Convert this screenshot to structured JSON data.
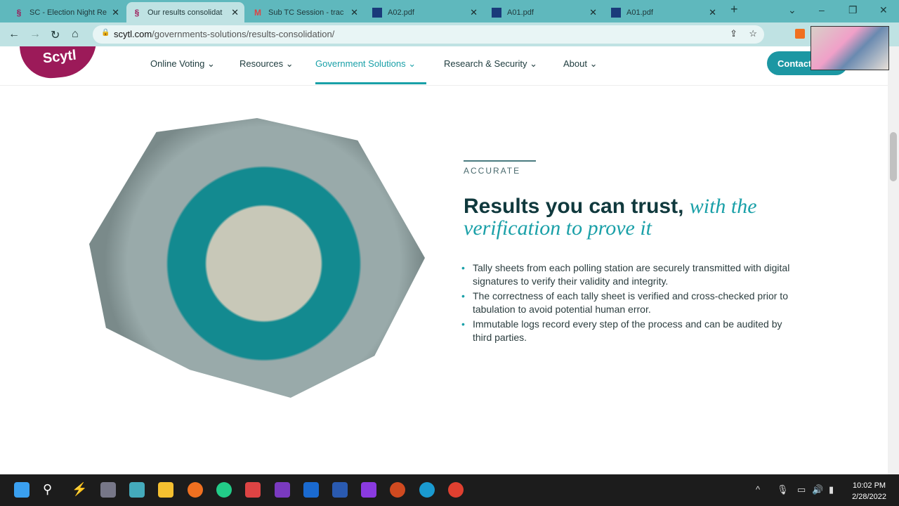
{
  "browser": {
    "tabs": [
      {
        "label": "SC - Election Night Re",
        "icon": "scytl-icon",
        "active": false
      },
      {
        "label": "Our results consolidat",
        "icon": "scytl-icon",
        "active": true
      },
      {
        "label": "Sub TC Session - trac",
        "icon": "gmail-icon",
        "active": false
      },
      {
        "label": "A02.pdf",
        "icon": "pdf-icon",
        "active": false
      },
      {
        "label": "A01.pdf",
        "icon": "pdf-icon",
        "active": false
      },
      {
        "label": "A01.pdf",
        "icon": "pdf-icon",
        "active": false
      }
    ],
    "url_host": "scytl.com",
    "url_path": "/governments-solutions/results-consolidation/"
  },
  "site": {
    "logo": "Scytl",
    "menu": [
      "Online Voting",
      "Resources",
      "Government Solutions",
      "Research & Security",
      "About"
    ],
    "active_menu": "Government Solutions",
    "contact": "Contact",
    "accent": "#1aa0a8",
    "brand": "#9c1a59"
  },
  "section": {
    "eyebrow": "ACCURATE",
    "title_bold": "Results you can trust,",
    "title_italic": "with the verification to prove it",
    "bullets": [
      "Tally sheets from each polling station are securely transmitted with digital signatures to verify their validity and integrity.",
      "The correctness of each tally sheet is verified and cross-checked prior to tabulation to avoid potential human error.",
      "Immutable logs record every step of the process and can be audited by third parties."
    ]
  },
  "taskbar": {
    "time": "10:02 PM",
    "date": "2/28/2022"
  }
}
